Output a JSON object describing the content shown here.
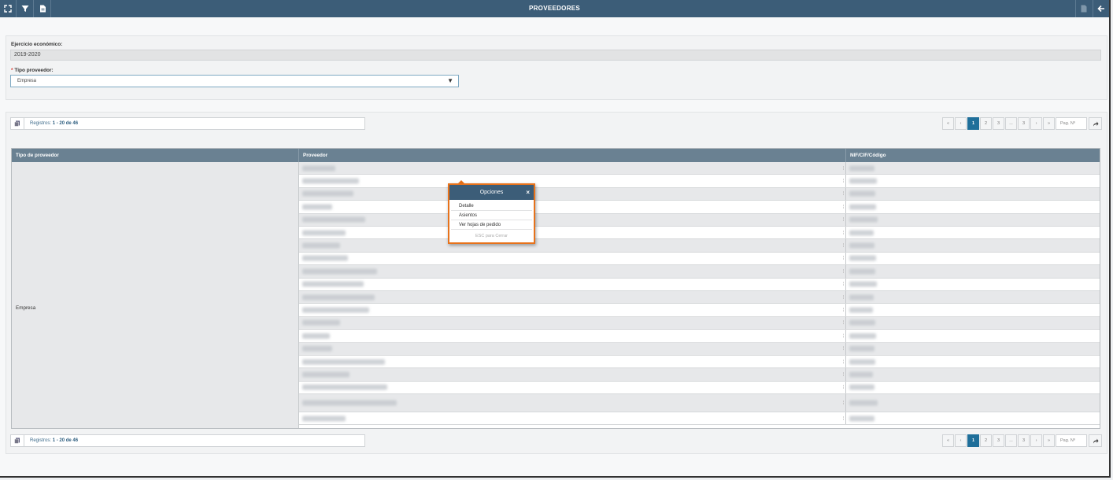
{
  "window": {
    "title": "PROVEEDORES",
    "accent": "#3c5d78",
    "left_icons": [
      "expand-icon",
      "filter-icon",
      "document-icon"
    ],
    "right_icons": [
      "export-icon",
      "back-arrow-icon"
    ]
  },
  "filters": {
    "ejercicio_label": "Ejercicio económico:",
    "ejercicio_value": "2019-2020",
    "tipo_required_mark": "*",
    "tipo_label": "Tipo proveedor:",
    "tipo_value": "Empresa"
  },
  "records": {
    "prefix": "Registros:",
    "range": "1 - 20 de 46"
  },
  "pagination": {
    "first": "«",
    "prev": "‹",
    "pages": [
      "1",
      "2",
      "3"
    ],
    "ellipsis": "...",
    "last_page": "3",
    "next": "›",
    "last": "»",
    "active_page": "1",
    "page_input_placeholder": "Pag. Nº"
  },
  "table": {
    "headers": [
      "Tipo de proveedor",
      "Proveedor",
      "NIF/CIF/Código"
    ],
    "group_value": "Empresa",
    "row_count": 20
  },
  "popup": {
    "title": "Opciones",
    "close": "×",
    "items": [
      "Detalle",
      "Asientos",
      "Ver hojas de pedido"
    ],
    "footer": "ESC para Cerrar",
    "border_color": "#e7721b"
  }
}
